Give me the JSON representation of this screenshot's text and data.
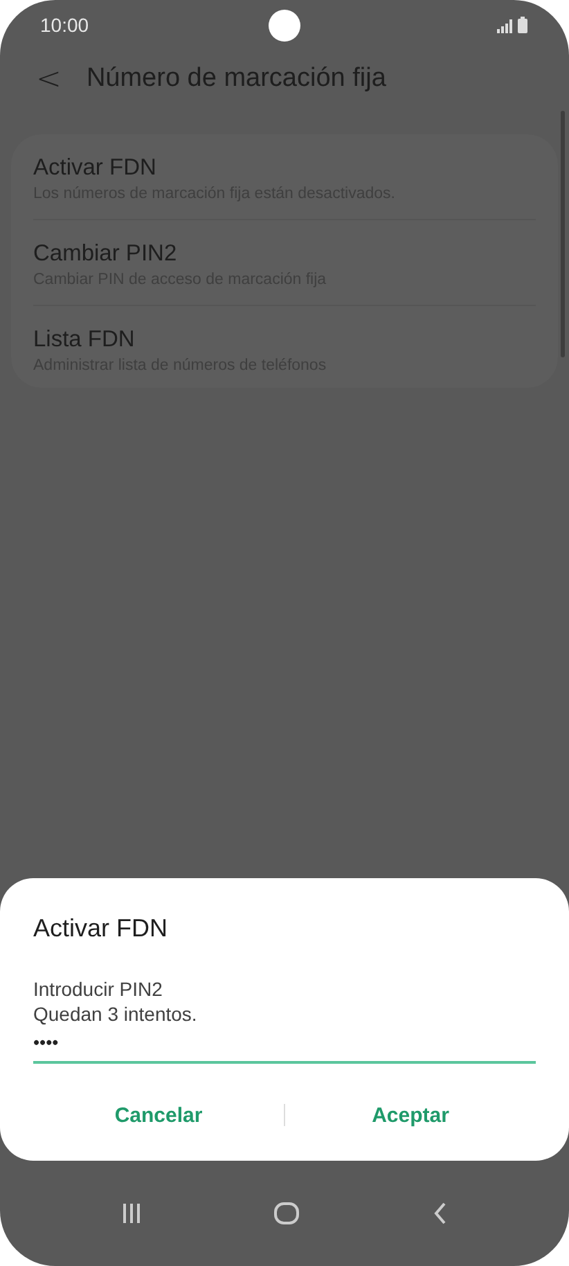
{
  "status_bar": {
    "time": "10:00"
  },
  "header": {
    "back": "<",
    "title": "Número de marcación fija"
  },
  "settings": [
    {
      "title": "Activar FDN",
      "subtitle": "Los números de marcación fija están desactivados."
    },
    {
      "title": "Cambiar PIN2",
      "subtitle": "Cambiar PIN de acceso de marcación fija"
    },
    {
      "title": "Lista FDN",
      "subtitle": "Administrar lista de números de teléfonos"
    }
  ],
  "dialog": {
    "title": "Activar FDN",
    "message": [
      "Introducir PIN2",
      "Quedan 3 intentos."
    ],
    "field": {
      "value": "••••",
      "focused": true
    },
    "buttons": [
      "Cancelar",
      "Aceptar"
    ]
  }
}
